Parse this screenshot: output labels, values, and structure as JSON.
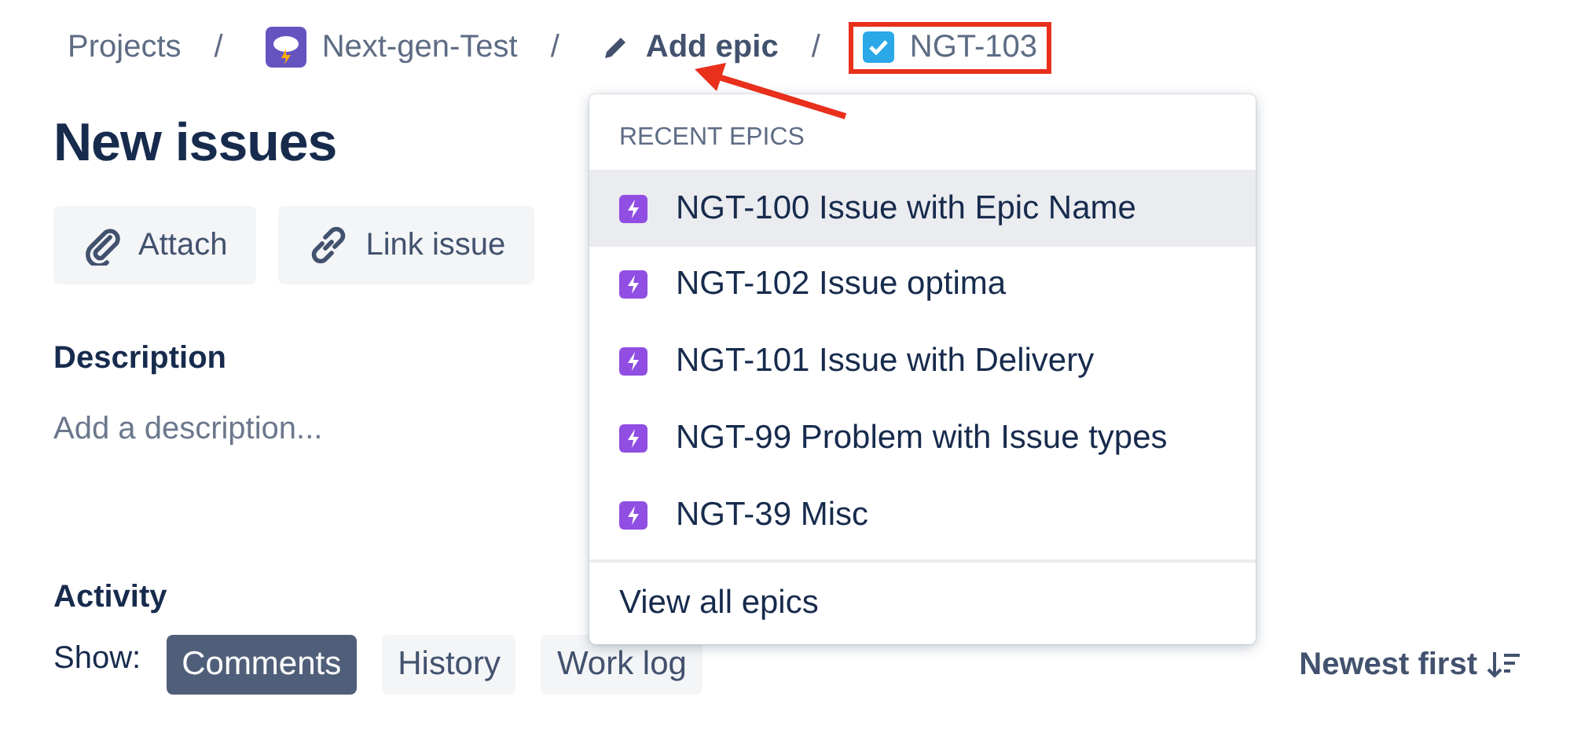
{
  "breadcrumbs": [
    {
      "kind": "link",
      "label": "Projects",
      "annotated": false
    },
    {
      "kind": "project",
      "label": "Next-gen-Test",
      "annotated": false
    },
    {
      "kind": "action",
      "label": "Add epic",
      "annotated": false
    },
    {
      "kind": "issue",
      "label": "NGT-103",
      "annotated": true
    }
  ],
  "separator": "/",
  "title": "New issues",
  "actions": [
    {
      "kind": "attach",
      "label": "Attach"
    },
    {
      "kind": "link",
      "label": "Link issue"
    }
  ],
  "description": {
    "heading": "Description",
    "placeholder": "Add a description..."
  },
  "activity": {
    "heading": "Activity",
    "show_label": "Show:",
    "filters": [
      {
        "label": "Comments",
        "selected": true
      },
      {
        "label": "History",
        "selected": false
      },
      {
        "label": "Work log",
        "selected": false
      }
    ],
    "sort": "Newest first"
  },
  "epic_menu": {
    "heading": "RECENT EPICS",
    "items": [
      {
        "label": "NGT-100 Issue with Epic Name",
        "selected": true
      },
      {
        "label": "NGT-102 Issue optima",
        "selected": false
      },
      {
        "label": "NGT-101 Issue with Delivery",
        "selected": false
      },
      {
        "label": "NGT-99 Problem with Issue types",
        "selected": false
      },
      {
        "label": "NGT-39 Misc",
        "selected": false
      }
    ],
    "footer": "View all epics"
  }
}
